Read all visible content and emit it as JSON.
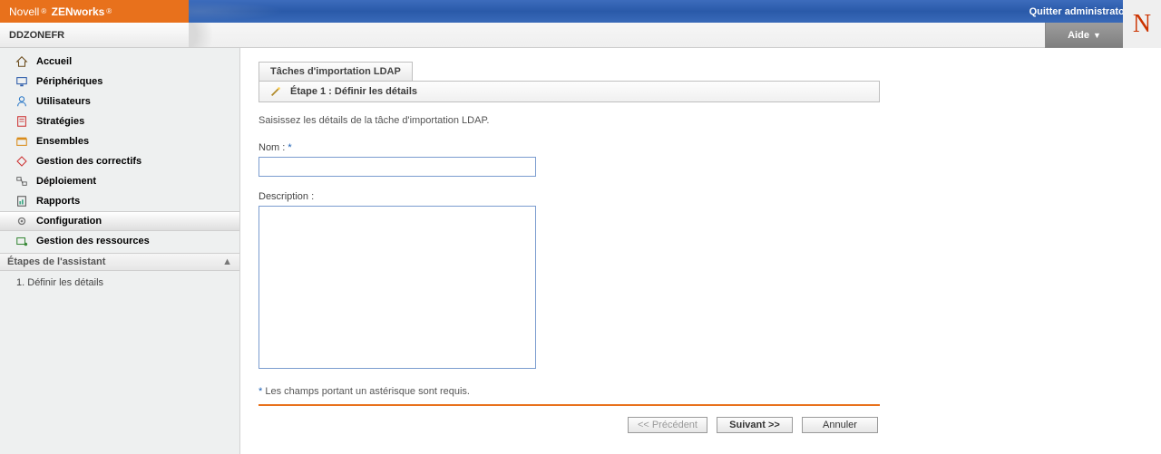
{
  "brand": {
    "company": "Novell",
    "product": "ZENworks"
  },
  "header": {
    "quit_label": "Quitter administrator",
    "help_label": "Aide"
  },
  "zone": {
    "name": "DDZONEFR"
  },
  "n_logo": "N",
  "nav": {
    "items": [
      {
        "key": "home",
        "label": "Accueil"
      },
      {
        "key": "devices",
        "label": "Périphériques"
      },
      {
        "key": "users",
        "label": "Utilisateurs"
      },
      {
        "key": "policies",
        "label": "Stratégies"
      },
      {
        "key": "bundles",
        "label": "Ensembles"
      },
      {
        "key": "patches",
        "label": "Gestion des correctifs"
      },
      {
        "key": "deploy",
        "label": "Déploiement"
      },
      {
        "key": "reports",
        "label": "Rapports"
      },
      {
        "key": "config",
        "label": "Configuration"
      },
      {
        "key": "resources",
        "label": "Gestion des ressources"
      }
    ],
    "active_key": "config"
  },
  "wizard": {
    "header": "Étapes de l'assistant",
    "steps": [
      {
        "num": "1.",
        "label": "Définir les détails"
      }
    ]
  },
  "panel": {
    "tab_title": "Tâches d'importation LDAP",
    "step_title": "Étape 1 : Définir les détails",
    "description": "Saisissez les détails de la tâche d'importation LDAP.",
    "name_label": "Nom :",
    "desc_label": "Description :",
    "name_value": "",
    "desc_value": "",
    "required_note": "Les champs portant un astérisque sont requis.",
    "asterisk": "*"
  },
  "buttons": {
    "prev": "<< Précédent",
    "next": "Suivant >>",
    "cancel": "Annuler"
  }
}
